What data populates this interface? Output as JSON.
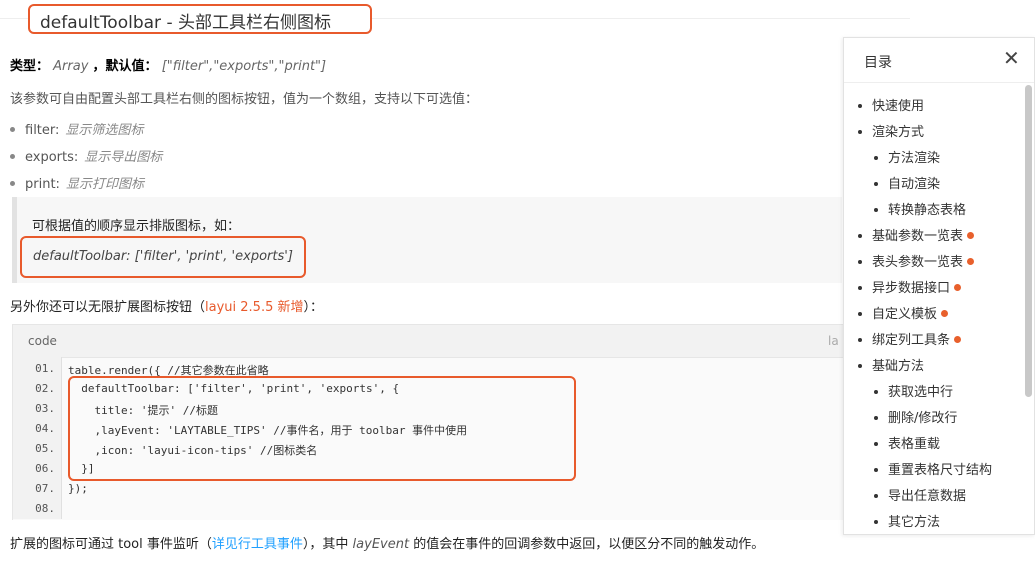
{
  "heading": {
    "title": "defaultToolbar - 头部工具栏右侧图标"
  },
  "type_line": {
    "type_label": "类型：",
    "type_value": "Array",
    "default_label": "，默认值：",
    "default_value": "[\"filter\",\"exports\",\"print\"]"
  },
  "description": "该参数可自由配置头部工具栏右侧的图标按钮，值为一个数组，支持以下可选值：",
  "options": [
    {
      "key": "filter:",
      "desc": "显示筛选图标"
    },
    {
      "key": "exports:",
      "desc": "显示导出图标"
    },
    {
      "key": "print:",
      "desc": "显示打印图标"
    }
  ],
  "quote": {
    "text": "可根据值的顺序显示排版图标，如：",
    "code": "defaultToolbar: ['filter', 'print', 'exports']"
  },
  "more": {
    "prefix": "另外你还可以无限扩展图标按钮（",
    "version": "layui 2.5.5 新增",
    "suffix": "）："
  },
  "code": {
    "header": "code",
    "lang": "la",
    "lines": [
      {
        "num": "01.",
        "text": "table.render({ //其它参数在此省略"
      },
      {
        "num": "02.",
        "text": "  defaultToolbar: ['filter', 'print', 'exports', {"
      },
      {
        "num": "03.",
        "text": "    title: '提示' //标题"
      },
      {
        "num": "04.",
        "text": "    ,layEvent: 'LAYTABLE_TIPS' //事件名，用于 toolbar 事件中使用"
      },
      {
        "num": "05.",
        "text": "    ,icon: 'layui-icon-tips' //图标类名"
      },
      {
        "num": "06.",
        "text": "  }]"
      },
      {
        "num": "07.",
        "text": "});"
      },
      {
        "num": "08.",
        "text": ""
      }
    ]
  },
  "bottom": {
    "prefix": "扩展的图标可通过 tool 事件监听（",
    "link": "详见行工具事件",
    "middle": "），其中 ",
    "italic": "layEvent",
    "suffix": " 的值会在事件的回调参数中返回，以便区分不同的触发动作。"
  },
  "toc": {
    "title": "目录",
    "close_icon": "close-icon",
    "items": [
      {
        "label": "快速使用",
        "level": 1,
        "new": false
      },
      {
        "label": "渲染方式",
        "level": 1,
        "new": false
      },
      {
        "label": "方法渲染",
        "level": 2,
        "new": false
      },
      {
        "label": "自动渲染",
        "level": 2,
        "new": false
      },
      {
        "label": "转换静态表格",
        "level": 2,
        "new": false
      },
      {
        "label": "基础参数一览表",
        "level": 1,
        "new": true
      },
      {
        "label": "表头参数一览表",
        "level": 1,
        "new": true
      },
      {
        "label": "异步数据接口",
        "level": 1,
        "new": true
      },
      {
        "label": "自定义模板",
        "level": 1,
        "new": true
      },
      {
        "label": "绑定列工具条",
        "level": 1,
        "new": true
      },
      {
        "label": "基础方法",
        "level": 1,
        "new": false
      },
      {
        "label": "获取选中行",
        "level": 2,
        "new": false
      },
      {
        "label": "删除/修改行",
        "level": 2,
        "new": false
      },
      {
        "label": "表格重载",
        "level": 2,
        "new": false
      },
      {
        "label": "重置表格尺寸结构",
        "level": 2,
        "new": false
      },
      {
        "label": "导出任意数据",
        "level": 2,
        "new": false
      },
      {
        "label": "其它方法",
        "level": 2,
        "new": false
      }
    ],
    "new_dot_color": "#e8602c"
  },
  "accent_color": "#e85a2c",
  "link_color": "#1e9fff"
}
